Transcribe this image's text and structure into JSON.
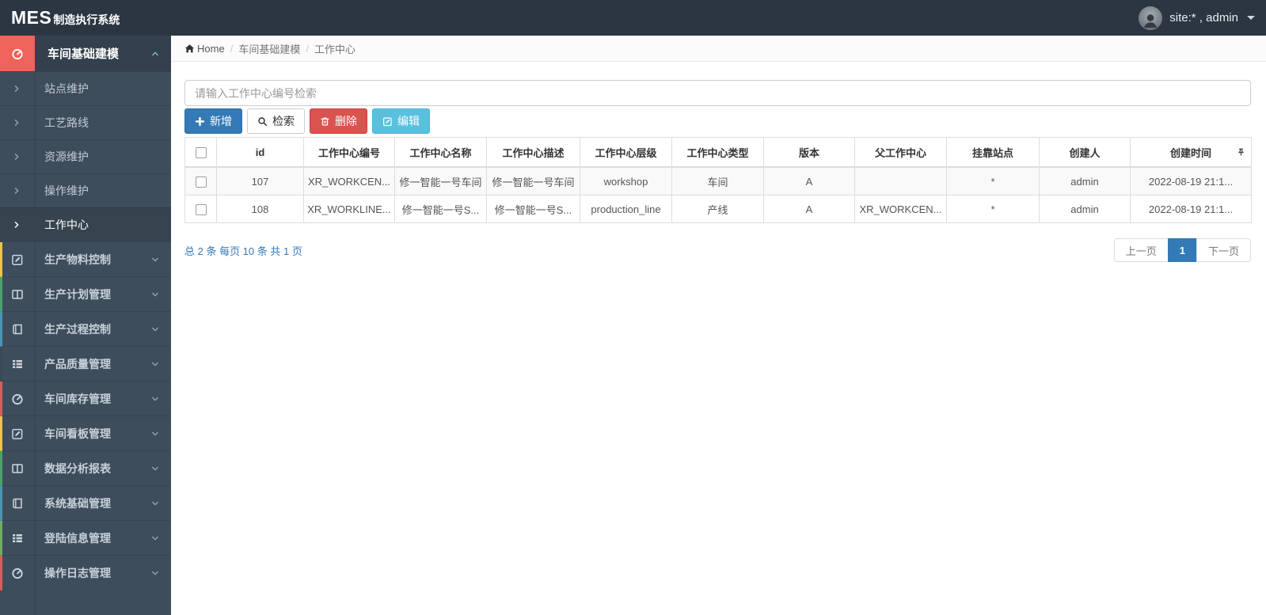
{
  "topbar": {
    "logo_main": "MES",
    "logo_sub": "制造执行系统",
    "user_label": "site:* , admin"
  },
  "sidebar": {
    "parent": {
      "label": "车间基础建模",
      "icon": "dashboard-icon"
    },
    "sub_items": [
      {
        "label": "站点维护"
      },
      {
        "label": "工艺路线"
      },
      {
        "label": "资源维护"
      },
      {
        "label": "操作维护"
      },
      {
        "label": "工作中心",
        "active": true
      }
    ],
    "sections": [
      {
        "label": "生产物料控制",
        "icon": "pencil-square-icon",
        "strip": "#e9c64a"
      },
      {
        "label": "生产计划管理",
        "icon": "columns-icon",
        "strip": "#4da06a"
      },
      {
        "label": "生产过程控制",
        "icon": "book-icon",
        "strip": "#4c93b4"
      },
      {
        "label": "产品质量管理",
        "icon": "th-list-icon",
        "strip": "#3a4956"
      },
      {
        "label": "车间库存管理",
        "icon": "dashboard-icon",
        "strip": "#d95c5c"
      },
      {
        "label": "车间看板管理",
        "icon": "pencil-square-icon",
        "strip": "#e9c64a"
      },
      {
        "label": "数据分析报表",
        "icon": "columns-icon",
        "strip": "#4da06a"
      },
      {
        "label": "系统基础管理",
        "icon": "book-icon",
        "strip": "#4c93b4"
      },
      {
        "label": "登陆信息管理",
        "icon": "th-list-icon",
        "strip": "#6fae62"
      },
      {
        "label": "操作日志管理",
        "icon": "dashboard-icon",
        "strip": "#d95c5c"
      }
    ]
  },
  "breadcrumb": {
    "home": "Home",
    "sep": "/",
    "crumbs": [
      "车间基础建模",
      "工作中心"
    ]
  },
  "toolbar": {
    "search_placeholder": "请输入工作中心编号检索",
    "add_label": "新增",
    "search_label": "检索",
    "delete_label": "删除",
    "edit_label": "编辑"
  },
  "table": {
    "headers": [
      "id",
      "工作中心编号",
      "工作中心名称",
      "工作中心描述",
      "工作中心层级",
      "工作中心类型",
      "版本",
      "父工作中心",
      "挂靠站点",
      "创建人",
      "创建时间"
    ],
    "rows": [
      [
        "107",
        "XR_WORKCEN...",
        "修一智能一号车间",
        "修一智能一号车间",
        "workshop",
        "车间",
        "A",
        "",
        "*",
        "admin",
        "2022-08-19 21:1..."
      ],
      [
        "108",
        "XR_WORKLINE...",
        "修一智能一号S...",
        "修一智能一号S...",
        "production_line",
        "产线",
        "A",
        "XR_WORKCEN...",
        "*",
        "admin",
        "2022-08-19 21:1..."
      ]
    ]
  },
  "pagination": {
    "summary": "总 2 条 每页 10 条 共 1 页",
    "prev_label": "上一页",
    "page": "1",
    "next_label": "下一页"
  },
  "colors": {
    "header_bg": "#2b3642",
    "sidebar_bg": "#3e4d5c",
    "active_icon_bg": "#f0635a",
    "primary": "#337ab7",
    "danger": "#d9534f",
    "info": "#5bc0de",
    "link": "#337ab7"
  }
}
